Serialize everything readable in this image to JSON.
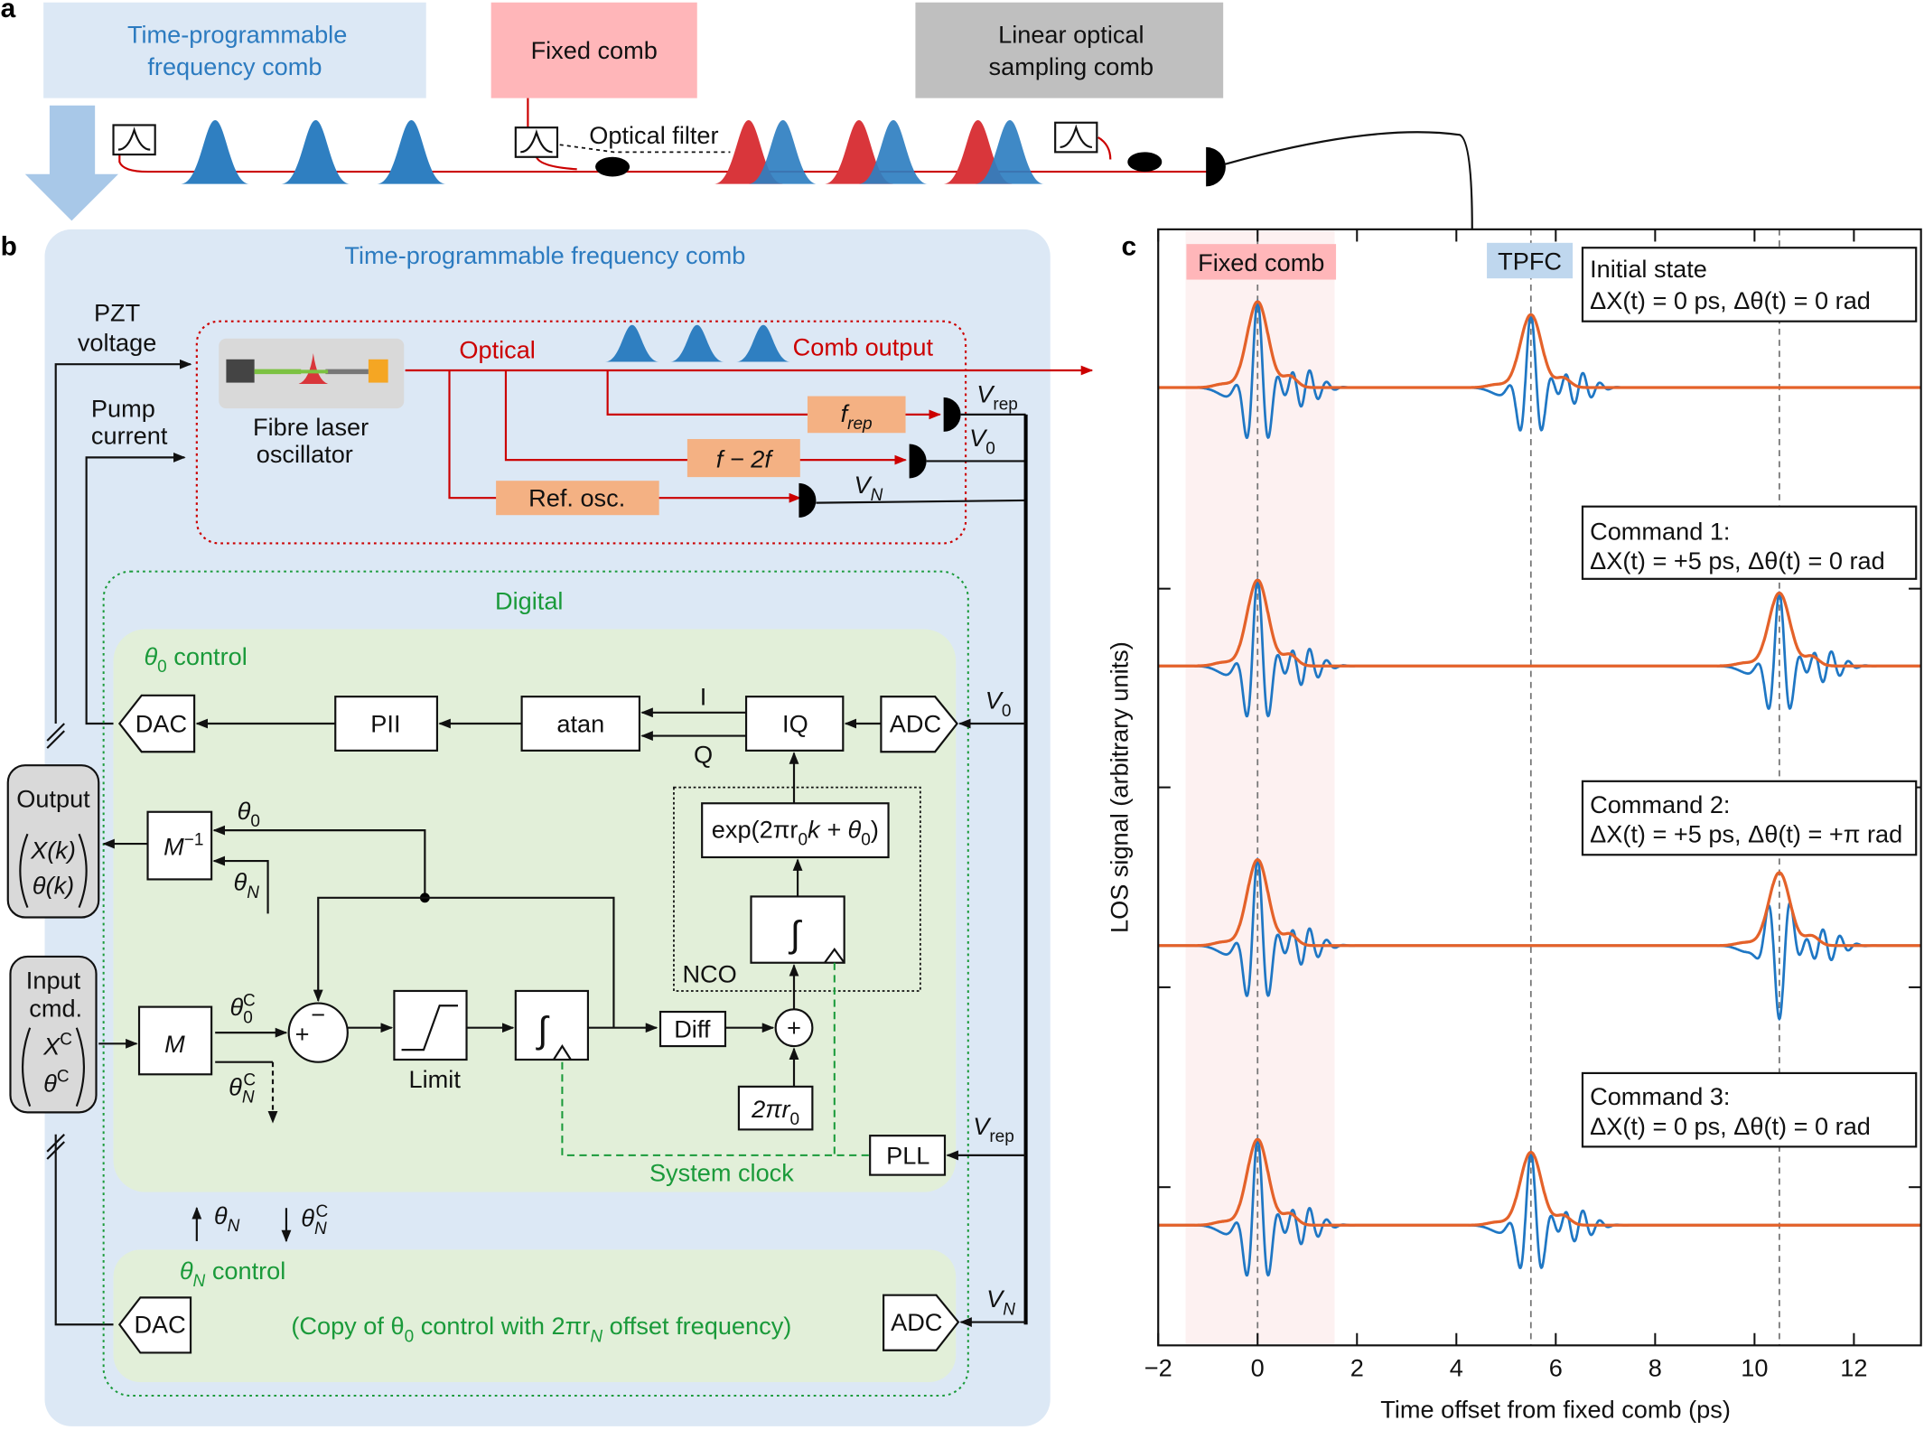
{
  "panel_labels": {
    "a": "a",
    "b": "b",
    "c": "c"
  },
  "panel_a": {
    "tpfc_box": [
      "Time-programmable",
      "frequency comb"
    ],
    "fixed_comb_box": "Fixed comb",
    "los_box": [
      "Linear optical",
      "sampling comb"
    ],
    "optical_filter_label": "Optical filter",
    "colors": {
      "tpfc": "#dce8f5",
      "fixed": "#ffb6b9",
      "los": "#bfbfbf",
      "fibre": "#cc0000",
      "blue_pulse": "#2f7fc1",
      "red_pulse": "#d9363b"
    }
  },
  "panel_b": {
    "title": "Time-programmable frequency comb",
    "pzt": [
      "PZT",
      "voltage"
    ],
    "pump": [
      "Pump",
      "current"
    ],
    "laser": [
      "Fibre laser",
      "oscillator"
    ],
    "optical": "Optical",
    "comb_output": "Comb output",
    "frep": {
      "main": "f",
      "sub": "rep"
    },
    "f2f": "f − 2f",
    "ref_osc": "Ref. osc.",
    "v_rep": {
      "main": "V",
      "sub": "rep"
    },
    "v_0": {
      "main": "V",
      "sub": "0"
    },
    "v_n": {
      "main": "V",
      "sub": "N"
    },
    "digital": "Digital",
    "theta0_control": {
      "main": "θ",
      "sub": "0",
      "rest": " control"
    },
    "dac": "DAC",
    "pii": "PII",
    "atan": "atan",
    "iq": "IQ",
    "adc": "ADC",
    "i": "I",
    "q": "Q",
    "exp": {
      "a": "exp(2πr",
      "sub": "0",
      "b": "k + θ",
      "sub2": "0",
      "c": ")"
    },
    "integral": "∫",
    "nco": "NCO",
    "output": {
      "title": "Output",
      "x": "X(k)",
      "theta": "θ(k)"
    },
    "input": {
      "title": [
        "Input",
        "cmd."
      ],
      "x": "X",
      "theta": "θ",
      "sup": "C"
    },
    "m_inv": {
      "main": "M",
      "sup": "−1"
    },
    "m": "M",
    "theta0": {
      "main": "θ",
      "sub": "0"
    },
    "thetaN": {
      "main": "θ",
      "sub": "N"
    },
    "theta0C": {
      "main": "θ",
      "sub": "0",
      "sup": "C"
    },
    "thetaNC": {
      "main": "θ",
      "sub": "N",
      "sup": "C"
    },
    "minus": "−",
    "plus": "+",
    "limit": "Limit",
    "diff": "Diff",
    "two_pi_r0": {
      "main": "2πr",
      "sub": "0"
    },
    "pll": "PLL",
    "system_clock": "System clock",
    "thetaN_control": {
      "main": "θ",
      "sub": "N",
      "rest": " control"
    },
    "copy_text": {
      "a": "(Copy of θ",
      "sub": "0",
      "b": " control with 2πr",
      "sub2": "N",
      "c": " offset frequency)"
    },
    "colors": {
      "panel_bg": "#dce8f5",
      "digital_bg": "#e2efd9",
      "digital_text": "#1a9a3a",
      "block_fill": "#f4b183"
    }
  },
  "chart_data": {
    "type": "line",
    "xlabel": "Time offset from fixed comb (ps)",
    "ylabel": "LOS signal (arbitrary units)",
    "xlim": [
      -2,
      13.35
    ],
    "xticks": [
      -2,
      0,
      2,
      4,
      6,
      8,
      10,
      12
    ],
    "xtick_labels": [
      "−2",
      "0",
      "2",
      "4",
      "6",
      "8",
      "10",
      "12"
    ],
    "reference_lines_ps": [
      0,
      5.5,
      10.5
    ],
    "fixed_comb_region_ps": [
      -1.45,
      1.55
    ],
    "tags": {
      "fixed": "Fixed comb",
      "tpfc": "TPFC"
    },
    "colors": {
      "signal": "#1f77c4",
      "envelope": "#e4622a",
      "fixed_region": "#fdf1f1",
      "fixed_tag": "#ffb6b9",
      "tpfc_tag": "#bfd7ee"
    },
    "traces": [
      {
        "title": "Initial state",
        "command": "ΔX(t) = 0 ps, Δθ(t) = 0 rad",
        "fixed_center_ps": 0,
        "tpfc_center_ps": 5.5,
        "tpfc_phase_rad": 0
      },
      {
        "title": "Command 1:",
        "command": "ΔX(t) = +5 ps, Δθ(t) = 0 rad",
        "fixed_center_ps": 0,
        "tpfc_center_ps": 10.5,
        "tpfc_phase_rad": 0
      },
      {
        "title": "Command 2:",
        "command": "ΔX(t) = +5 ps, Δθ(t) = +π rad",
        "fixed_center_ps": 0,
        "tpfc_center_ps": 10.5,
        "tpfc_phase_rad": 3.1416
      },
      {
        "title": "Command 3:",
        "command": "ΔX(t) = 0 ps, Δθ(t) = 0 rad",
        "fixed_center_ps": 0,
        "tpfc_center_ps": 5.5,
        "tpfc_phase_rad": 0
      }
    ]
  }
}
